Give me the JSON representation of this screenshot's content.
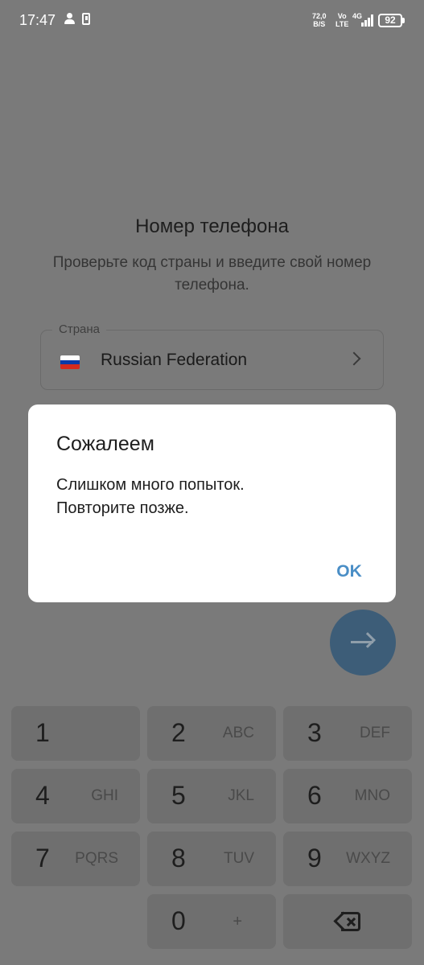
{
  "status_bar": {
    "time": "17:47",
    "net_speed_value": "72,0",
    "net_speed_unit": "B/S",
    "volte_top": "Vo",
    "volte_bottom": "LTE",
    "network_type": "4G",
    "battery": "92"
  },
  "screen": {
    "title": "Номер телефона",
    "subtitle": "Проверьте код страны и введите свой номер телефона.",
    "country_label": "Страна",
    "country_name": "Russian Federation",
    "country_flag": "russia-flag"
  },
  "dialog": {
    "title": "Сожалеем",
    "message": "Слишком много попыток.\nПовторите позже.",
    "ok_label": "OK"
  },
  "keypad": {
    "keys": [
      {
        "digit": "1",
        "letters": ""
      },
      {
        "digit": "2",
        "letters": "ABC"
      },
      {
        "digit": "3",
        "letters": "DEF"
      },
      {
        "digit": "4",
        "letters": "GHI"
      },
      {
        "digit": "5",
        "letters": "JKL"
      },
      {
        "digit": "6",
        "letters": "MNO"
      },
      {
        "digit": "7",
        "letters": "PQRS"
      },
      {
        "digit": "8",
        "letters": "TUV"
      },
      {
        "digit": "9",
        "letters": "WXYZ"
      },
      {
        "digit": "0",
        "letters": "+"
      }
    ]
  },
  "colors": {
    "overlay_background": "#7a7a7a",
    "accent": "#4a8ec6",
    "fab": "#3d5d78",
    "dialog_background": "#ffffff"
  }
}
